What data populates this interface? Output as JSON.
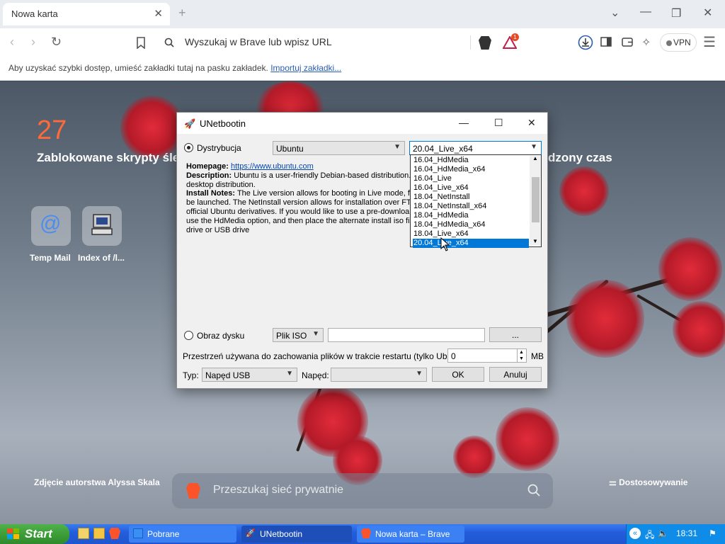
{
  "browser": {
    "tab_title": "Nowa karta",
    "address_placeholder": "Wyszukaj w Brave lub wpisz URL",
    "vpn_label": "VPN",
    "notification_count": "1",
    "bookmarks_text": "Aby uzyskać szybki dostęp, umieść zakładki tutaj na pasku zakładek.",
    "bookmarks_link": "Importuj zakładki..."
  },
  "ntp": {
    "stat_number": "27",
    "stat_label_left": "Zablokowane skrypty śle",
    "stat_label_right": "dzony czas",
    "sites": [
      {
        "label": "Temp Mail"
      },
      {
        "label": "Index of /l..."
      }
    ],
    "photo_credit": "Zdjęcie autorstwa Alyssa Skala",
    "customize_label": "Dostosowywanie",
    "search_placeholder": "Przeszukaj sieć prywatnie"
  },
  "unetbootin": {
    "title": "UNetbootin",
    "distribution_label": "Dystrybucja",
    "distribution_value": "Ubuntu",
    "version_value": "20.04_Live_x64",
    "desc": {
      "homepage_label": "Homepage:",
      "homepage_url": "https://www.ubuntu.com",
      "description_label": "Description:",
      "description_text1": "Ubuntu is a user-friendly Debian-based distribution.",
      "description_text2": "desktop distribution.",
      "install_label": "Install Notes:",
      "install_text1": "The Live version allows for booting in Live mode, f",
      "install_text2": "be launched. The NetInstall version allows for installation over FTP",
      "install_text3": "official Ubuntu derivatives. If you would like to use a pre-downloa",
      "install_text4": "use the HdMedia option, and then place the alternate install iso fil",
      "install_text5": "drive or USB drive"
    },
    "dropdown_items": [
      "16.04_HdMedia",
      "16.04_HdMedia_x64",
      "16.04_Live",
      "16.04_Live_x64",
      "18.04_NetInstall",
      "18.04_NetInstall_x64",
      "18.04_HdMedia",
      "18.04_HdMedia_x64",
      "18.04_Live_x64",
      "20.04_Live_x64"
    ],
    "disk_image_label": "Obraz dysku",
    "image_type_value": "Plik ISO",
    "browse_label": "...",
    "space_label": "Przestrzeń używana do zachowania plików w trakcie restartu (tylko Ubuntu):",
    "space_value": "0",
    "space_unit": "MB",
    "type_label": "Typ:",
    "type_value": "Napęd USB",
    "drive_label": "Napęd:",
    "drive_value": "",
    "ok_label": "OK",
    "cancel_label": "Anuluj"
  },
  "taskbar": {
    "start_label": "Start",
    "tasks": [
      {
        "label": "Pobrane"
      },
      {
        "label": "UNetbootin"
      },
      {
        "label": "Nowa karta – Brave"
      }
    ],
    "clock": "18:31"
  },
  "colors": {
    "accent": "#0078d7",
    "stat": "#ff6a3a",
    "taskbar": "#245edb"
  }
}
